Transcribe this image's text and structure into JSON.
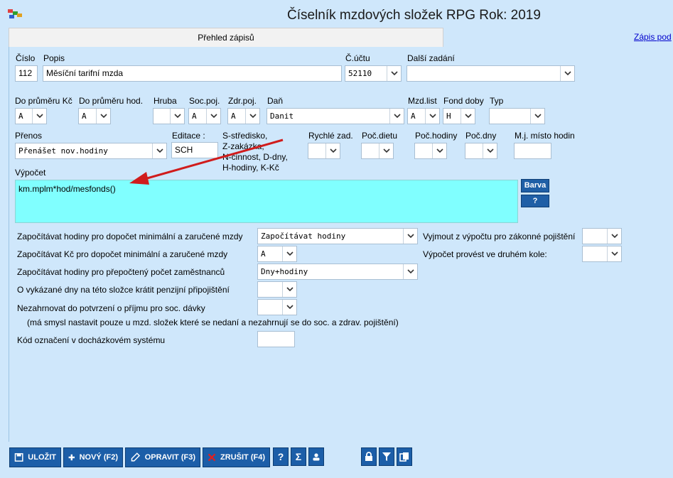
{
  "window": {
    "title": "Číselník mzdových složek  RPG  Rok: 2019"
  },
  "tabs": {
    "active": "Přehled zápisů",
    "link": "Zápis pod"
  },
  "row1": {
    "cislo_label": "Číslo",
    "cislo_value": "112",
    "popis_label": "Popis",
    "popis_value": "Měsíční tarifní mzda",
    "ucet_label": "Č.účtu",
    "ucet_value": "52110",
    "dalsi_label": "Další zadání",
    "dalsi_value": ""
  },
  "row2": {
    "prumer_kc_label": "Do průměru Kč",
    "prumer_kc_value": "A",
    "prumer_hod_label": "Do průměru hod.",
    "prumer_hod_value": "A",
    "hruba_label": "Hruba",
    "hruba_value": "",
    "soc_label": "Soc.poj.",
    "soc_value": "A",
    "zdr_label": "Zdr.poj.",
    "zdr_value": "A",
    "dan_label": "Daň",
    "dan_value": "Danit",
    "mzdlist_label": "Mzd.list",
    "mzdlist_value": "A",
    "fond_label": "Fond doby",
    "fond_value": "H",
    "typ_label": "Typ",
    "typ_value": ""
  },
  "row3": {
    "prenos_label": "Přenos",
    "prenos_value": "Přenášet nov.hodiny",
    "editace_label": "Editace :",
    "editace_value": "SCH",
    "editace_hint": [
      "S-středisko,",
      "Z-zakázka,",
      "N-činnost, D-dny,",
      "H-hodiny, K-Kč"
    ],
    "rychle_label": "Rychlé zad.",
    "pocdietu_label": "Poč.dietu",
    "pochodiny_label": "Poč.hodiny",
    "pocdny_label": "Poč.dny",
    "mj_label": "M.j. místo hodin"
  },
  "vypocet": {
    "label": "Výpočet",
    "formula": "km.mplm*hod/mesfonds()",
    "barva_button": "Barva",
    "help_button": "?"
  },
  "options": {
    "zapocitavat_hod_min_label": "Započítávat hodiny pro dopočet minimální a zaručené mzdy",
    "zapocitavat_hod_min_value": "Započítávat hodiny",
    "zapocitavat_kc_min_label": "Započítávat Kč pro dopočet minimální a zaručené mzdy",
    "zapocitavat_kc_min_value": "A",
    "zapocitavat_prepocet_label": "Započítávat hodiny pro přepočtený počet zaměstnanců",
    "zapocitavat_prepocet_value": "Dny+hodiny",
    "penzijni_label": "O vykázané dny na této složce krátit penzijní připojištění",
    "penzijni_value": "",
    "nezahrnovat_label": "Nezahrnovat do potvrzení o příjmu pro soc. dávky",
    "nezahrnovat_value": "",
    "nezahrnovat_note": "(má smysl nastavit pouze u mzd. složek které se nedaní a nezahrnují se do soc. a zdrav. pojištění)",
    "kod_label": "Kód označení v docházkovém systému",
    "kod_value": "",
    "vyjmout_label": "Vyjmout z výpočtu pro zákonné pojištění",
    "vyjmout_value": "",
    "druhe_kolo_label": "Výpočet provést ve druhém kole:",
    "druhe_kolo_value": ""
  },
  "toolbar": {
    "save": "ULOŽIT",
    "new": "NOVÝ (F2)",
    "edit": "OPRAVIT (F3)",
    "cancel": "ZRUŠIT (F4)",
    "help": "?",
    "sum": "Σ"
  },
  "colors": {
    "background": "#cfe7fb",
    "formula_bg": "#80ffff",
    "button_blue": "#1c5ea8",
    "arrow_red": "#d01c1c"
  }
}
